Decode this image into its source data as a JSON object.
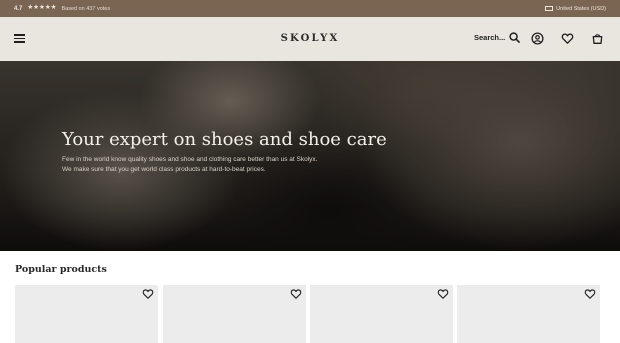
{
  "topbar": {
    "rating": "4.7",
    "stars": "★★★★★",
    "votes": "Based on 437 votes",
    "region": "United States (USD)"
  },
  "header": {
    "logo": "SKOLYX",
    "search_label": "Search...",
    "icons": [
      "menu-icon",
      "search-icon",
      "account-icon",
      "heart-icon",
      "bag-icon"
    ]
  },
  "hero": {
    "headline": "Your expert on shoes and shoe care",
    "line1": "Few in the world know quality shoes and shoe and clothing care better than us at Skolyx.",
    "line2": "We make sure that you get world class products at hard-to-beat prices."
  },
  "popular": {
    "title": "Popular products",
    "cards": [
      {
        "wishlist": "heart-icon"
      },
      {
        "wishlist": "heart-icon"
      },
      {
        "wishlist": "heart-icon"
      },
      {
        "wishlist": "heart-icon"
      }
    ]
  },
  "colors": {
    "topbar_bg": "#7a6552",
    "header_bg": "#e9e6e0",
    "card_bg": "#ececec"
  }
}
